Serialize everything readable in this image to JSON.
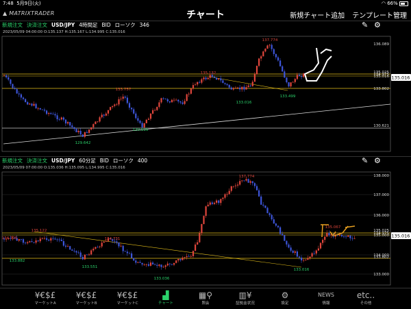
{
  "status": {
    "time": "7:48",
    "date": "5月9日(火)",
    "battery": "66%",
    "battery_fraction": 0.66
  },
  "header": {
    "logo": "MATRIXTRADER",
    "title": "チャート",
    "btn_add": "新規チャート追加",
    "btn_template": "テンプレート管理"
  },
  "chart1": {
    "order_new": "新規注文",
    "order_settle": "決済注文",
    "pair": "USD/JPY",
    "timeframe": "4時間足",
    "side": "BID",
    "type": "ローソク",
    "count": "346",
    "ohlc": "2023/05/09 04:00:00   O:135.137   H:135.167   L:134.995   C:135.016",
    "current_price": "135.016",
    "price_labels": [
      "136.089",
      "135.016",
      "133.802",
      "130.621"
    ],
    "line_labels": [
      "135.025",
      "134.975"
    ],
    "annotations": [
      "137.774",
      "135.132",
      "133.757",
      "133.016",
      "133.499",
      "130.616",
      "129.642"
    ]
  },
  "chart2": {
    "order_new": "新規注文",
    "order_settle": "決済注文",
    "pair": "USD/JPY",
    "timeframe": "60分足",
    "side": "BID",
    "type": "ローソク",
    "count": "400",
    "ohlc": "2023/05/09 07:00:00   O:135.036   H:135.095   L:134.995   C:135.016",
    "current_price": "135.016",
    "price_labels": [
      "138.000",
      "137.000",
      "136.000",
      "135.000",
      "134.000",
      "133.000"
    ],
    "line_labels": [
      "133.802",
      "135.025",
      "134.975"
    ],
    "annotations": [
      "137.774",
      "135.122",
      "134.705",
      "134.731",
      "135.067",
      "133.882",
      "133.551",
      "133.016",
      "133.499",
      "133.036"
    ]
  },
  "tabs": [
    {
      "icon": "¥€$£",
      "label": "マーケットA"
    },
    {
      "icon": "¥€$£",
      "label": "マーケットB"
    },
    {
      "icon": "¥€$£",
      "label": "マーケットC"
    },
    {
      "icon": "▟",
      "label": "チャート"
    },
    {
      "icon": "▦⚲",
      "label": "照会"
    },
    {
      "icon": "▥¥",
      "label": "証拠金状況"
    },
    {
      "icon": "⚙",
      "label": "設定"
    },
    {
      "icon": "NEWS",
      "label": "情報"
    },
    {
      "icon": "etc..",
      "label": "その他"
    }
  ],
  "colors": {
    "up": "#e0463c",
    "down": "#3d55d9",
    "accent": "#2bd26b",
    "hline": "#e8c21a"
  }
}
